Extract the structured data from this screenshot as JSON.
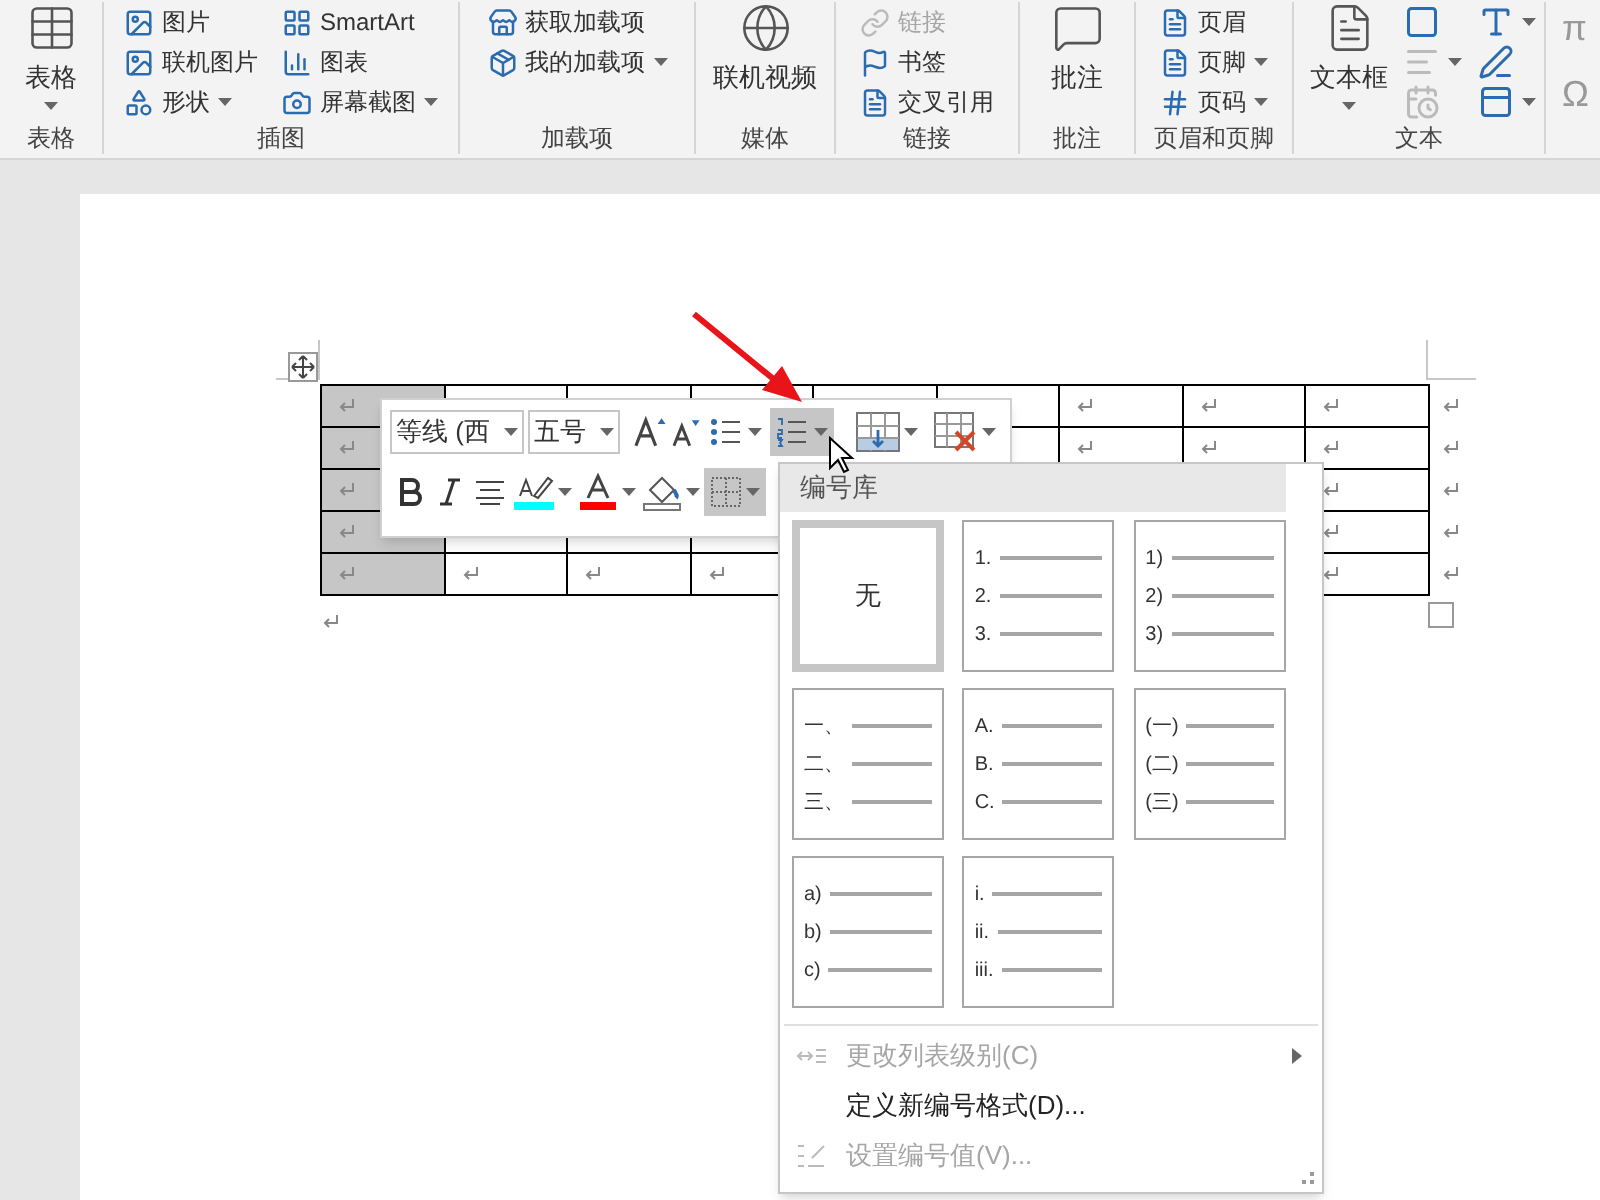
{
  "ribbon": {
    "groups": [
      {
        "label": "表格",
        "items": [
          {
            "kind": "large",
            "label": "表格",
            "dropdown": true,
            "disabled": false
          }
        ]
      },
      {
        "label": "插图",
        "items": [
          {
            "kind": "small",
            "label": "图片",
            "dropdown": false,
            "disabled": false
          },
          {
            "kind": "small",
            "label": "联机图片",
            "dropdown": false,
            "disabled": false
          },
          {
            "kind": "small",
            "label": "形状",
            "dropdown": true,
            "disabled": false
          },
          {
            "kind": "small",
            "label": "SmartArt",
            "dropdown": false,
            "disabled": false
          },
          {
            "kind": "small",
            "label": "图表",
            "dropdown": false,
            "disabled": false
          },
          {
            "kind": "small",
            "label": "屏幕截图",
            "dropdown": true,
            "disabled": false
          }
        ]
      },
      {
        "label": "加载项",
        "items": [
          {
            "kind": "small",
            "label": "获取加载项",
            "dropdown": false,
            "disabled": false
          },
          {
            "kind": "small",
            "label": "我的加载项",
            "dropdown": true,
            "disabled": false
          }
        ]
      },
      {
        "label": "媒体",
        "items": [
          {
            "kind": "large",
            "label": "联机视频",
            "dropdown": false,
            "disabled": false
          }
        ]
      },
      {
        "label": "链接",
        "items": [
          {
            "kind": "small",
            "label": "链接",
            "dropdown": false,
            "disabled": true
          },
          {
            "kind": "small",
            "label": "书签",
            "dropdown": false,
            "disabled": false
          },
          {
            "kind": "small",
            "label": "交叉引用",
            "dropdown": false,
            "disabled": false
          }
        ]
      },
      {
        "label": "批注",
        "items": [
          {
            "kind": "large",
            "label": "批注",
            "dropdown": false,
            "disabled": false
          }
        ]
      },
      {
        "label": "页眉和页脚",
        "items": [
          {
            "kind": "small",
            "label": "页眉",
            "dropdown": false,
            "disabled": false
          },
          {
            "kind": "small",
            "label": "页脚",
            "dropdown": true,
            "disabled": false
          },
          {
            "kind": "small",
            "label": "页码",
            "dropdown": true,
            "disabled": false
          }
        ]
      },
      {
        "label": "文本",
        "items": [
          {
            "kind": "large",
            "label": "文本框",
            "dropdown": true,
            "disabled": false
          },
          {
            "kind": "icon",
            "dropdown": false,
            "disabled": false
          },
          {
            "kind": "icon",
            "dropdown": true,
            "disabled": false
          },
          {
            "kind": "icon",
            "dropdown": true,
            "disabled": true
          },
          {
            "kind": "icon",
            "dropdown": false,
            "disabled": false
          },
          {
            "kind": "icon",
            "dropdown": false,
            "disabled": true
          },
          {
            "kind": "icon",
            "dropdown": true,
            "disabled": false
          }
        ]
      }
    ],
    "partial_symbols": [
      "π",
      "Ω"
    ]
  },
  "table": {
    "columns": [
      {
        "selected": true
      },
      {
        "selected": false
      },
      {
        "selected": false
      },
      {
        "selected": false
      },
      {
        "selected": false
      },
      {
        "selected": false
      },
      {
        "selected": false
      },
      {
        "selected": false
      },
      {
        "selected": false
      }
    ]
  },
  "mini_toolbar": {
    "font": "等线 (西",
    "size": "五号",
    "numbering_selected": true,
    "borders_selected": true
  },
  "numbering_menu": {
    "title": "编号库",
    "tiles": [
      {
        "kind": "none",
        "label": "无",
        "selected": true
      },
      {
        "kind": "list",
        "selected": false,
        "numbers": [
          "1.",
          "2.",
          "3."
        ]
      },
      {
        "kind": "list",
        "selected": false,
        "numbers": [
          "1)",
          "2)",
          "3)"
        ]
      },
      {
        "kind": "list",
        "selected": false,
        "numbers": [
          "一、",
          "二、",
          "三、"
        ]
      },
      {
        "kind": "list",
        "selected": false,
        "numbers": [
          "A.",
          "B.",
          "C."
        ]
      },
      {
        "kind": "list",
        "selected": false,
        "numbers": [
          "(一)",
          "(二)",
          "(三)"
        ]
      },
      {
        "kind": "list",
        "selected": false,
        "numbers": [
          "a)",
          "b)",
          "c)"
        ]
      },
      {
        "kind": "list",
        "selected": false,
        "numbers": [
          "i.",
          "ii.",
          "iii."
        ]
      }
    ],
    "items": [
      {
        "label": "更改列表级别(C)",
        "disabled": true,
        "submenu": true
      },
      {
        "label": "定义新编号格式(D)...",
        "disabled": false,
        "submenu": false
      },
      {
        "label": "设置编号值(V)...",
        "disabled": true,
        "submenu": false
      }
    ]
  }
}
